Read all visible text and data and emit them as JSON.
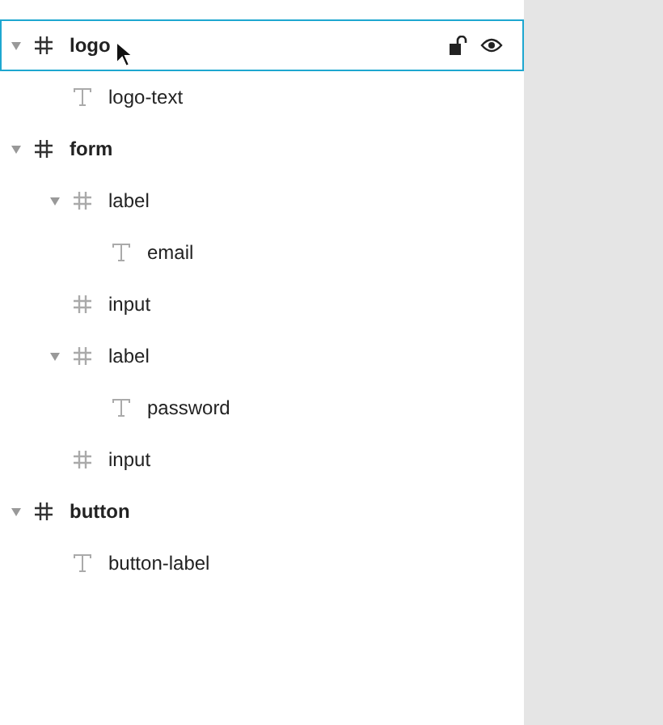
{
  "layers": [
    {
      "name": "logo",
      "kind": "frame",
      "selected": true,
      "expanded": true,
      "locked": false,
      "visible": true,
      "children": [
        {
          "name": "logo-text",
          "kind": "text",
          "selected": false
        }
      ]
    },
    {
      "name": "form",
      "kind": "frame",
      "selected": false,
      "expanded": true,
      "children": [
        {
          "name": "label",
          "kind": "frame",
          "selected": false,
          "expanded": true,
          "children": [
            {
              "name": "email",
              "kind": "text",
              "selected": false
            }
          ]
        },
        {
          "name": "input",
          "kind": "frame",
          "selected": false
        },
        {
          "name": "label",
          "kind": "frame",
          "selected": false,
          "expanded": true,
          "children": [
            {
              "name": "password",
              "kind": "text",
              "selected": false
            }
          ]
        },
        {
          "name": "input",
          "kind": "frame",
          "selected": false
        }
      ]
    },
    {
      "name": "button",
      "kind": "frame",
      "selected": false,
      "expanded": true,
      "children": [
        {
          "name": "button-label",
          "kind": "text",
          "selected": false
        }
      ]
    }
  ]
}
